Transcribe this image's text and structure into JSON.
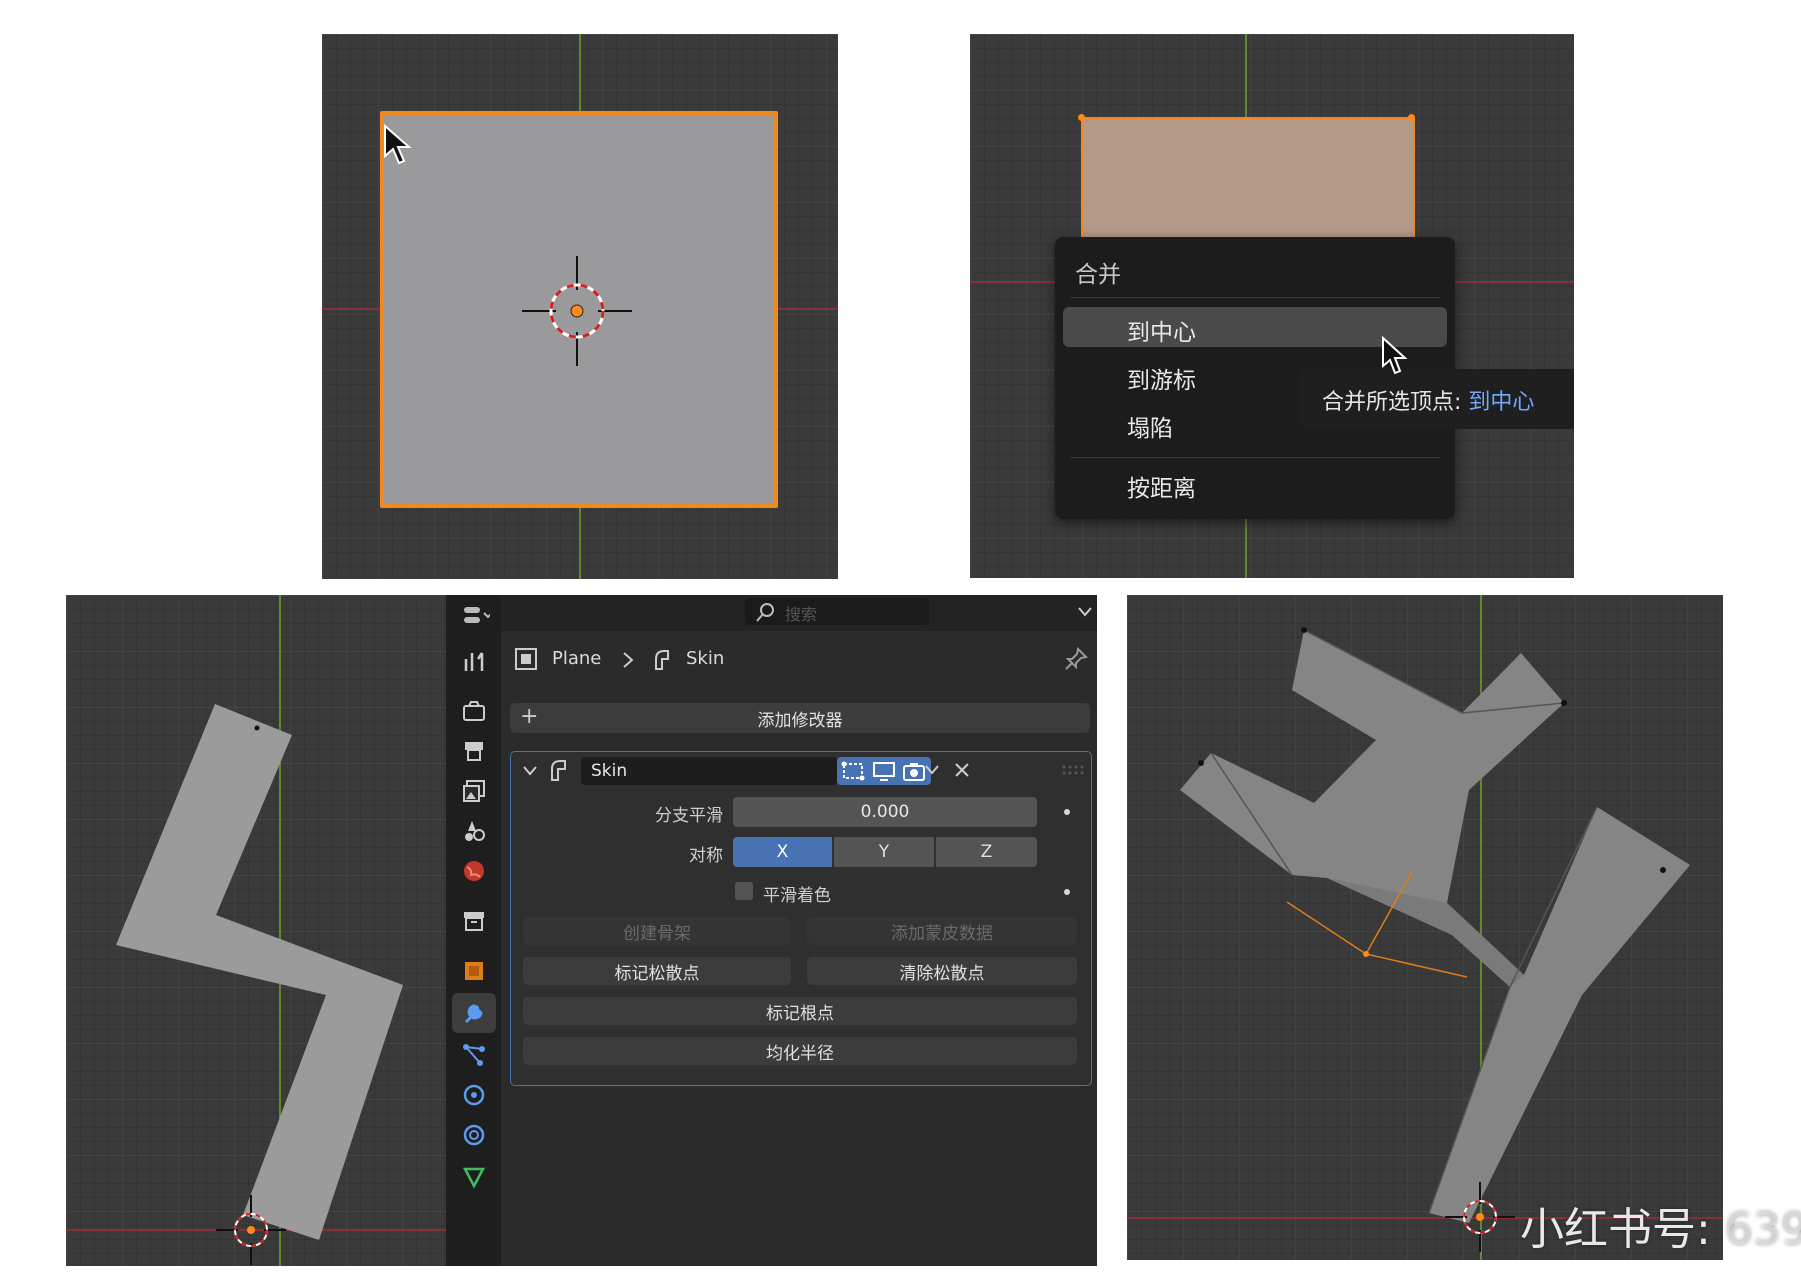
{
  "merge_menu": {
    "title": "合并",
    "items": [
      "到中心",
      "到游标",
      "塌陷",
      "按距离"
    ],
    "tooltip_prefix": "合并所选顶点: ",
    "tooltip_value": "到中心"
  },
  "properties": {
    "search_placeholder": "搜索",
    "breadcrumb_object": "Plane",
    "breadcrumb_modifier": "Skin",
    "add_modifier_label": "添加修改器",
    "modifier": {
      "name": "Skin",
      "branch_smoothing_label": "分支平滑",
      "branch_smoothing_value": "0.000",
      "symmetry_label": "对称",
      "symmetry_axes": [
        "X",
        "Y",
        "Z"
      ],
      "symmetry_active": "X",
      "smooth_shading_label": "平滑着色",
      "create_armature_label": "创建骨架",
      "add_skin_data_label": "添加蒙皮数据",
      "mark_loose_label": "标记松散点",
      "clear_loose_label": "清除松散点",
      "mark_root_label": "标记根点",
      "equalize_radii_label": "均化半径"
    }
  },
  "watermark": {
    "text": "小红书号: ",
    "id": "639"
  },
  "colors": {
    "selection_orange": "#f08a1e",
    "accent_blue": "#4772b3",
    "x_axis": "#8a2f3a",
    "y_axis": "#5d8a2a"
  }
}
